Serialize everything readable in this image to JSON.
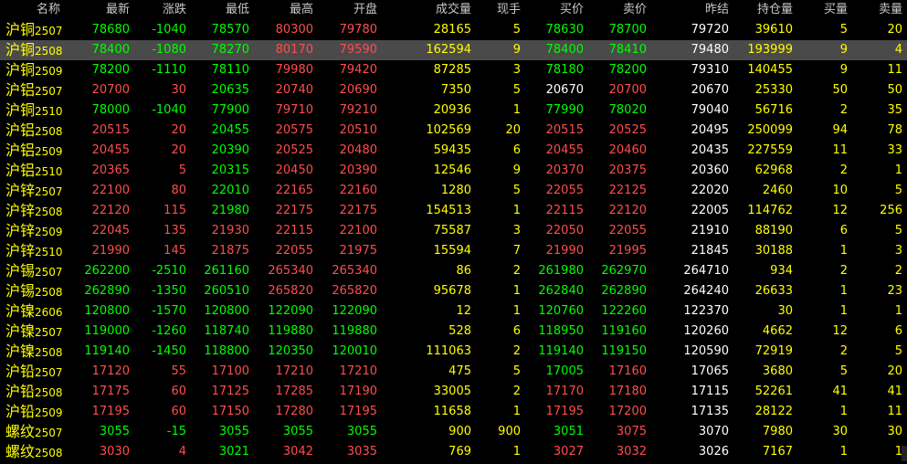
{
  "colors": {
    "up": "#ff4d4d",
    "down": "#00ff00",
    "flat": "#ffffff",
    "accent": "#ffff00",
    "header": "#c8c8c8",
    "selected_row": "#4a4a4a"
  },
  "columns": [
    {
      "key": "name",
      "label": "名称"
    },
    {
      "key": "last",
      "label": "最新"
    },
    {
      "key": "change",
      "label": "涨跌"
    },
    {
      "key": "low",
      "label": "最低"
    },
    {
      "key": "high",
      "label": "最高"
    },
    {
      "key": "open",
      "label": "开盘"
    },
    {
      "key": "volume",
      "label": "成交量"
    },
    {
      "key": "hand",
      "label": "现手"
    },
    {
      "key": "bid",
      "label": "买价"
    },
    {
      "key": "ask",
      "label": "卖价"
    },
    {
      "key": "prev_settle",
      "label": "昨结"
    },
    {
      "key": "oi",
      "label": "持仓量"
    },
    {
      "key": "bid_vol",
      "label": "买量"
    },
    {
      "key": "ask_vol",
      "label": "卖量"
    }
  ],
  "selected_index": 1,
  "rows": [
    {
      "cn": "沪铜",
      "code": "2507",
      "last": "78680",
      "change": "-1040",
      "low": "78570",
      "high": "80300",
      "open": "79780",
      "volume": "28165",
      "hand": "5",
      "bid": "78630",
      "ask": "78700",
      "prev_settle": "79720",
      "oi": "39610",
      "bid_vol": "5",
      "ask_vol": "20",
      "c": {
        "last": "down",
        "change": "down",
        "low": "down",
        "high": "up",
        "open": "up",
        "bid": "down",
        "ask": "down"
      }
    },
    {
      "cn": "沪铜",
      "code": "2508",
      "last": "78400",
      "change": "-1080",
      "low": "78270",
      "high": "80170",
      "open": "79590",
      "volume": "162594",
      "hand": "9",
      "bid": "78400",
      "ask": "78410",
      "prev_settle": "79480",
      "oi": "193999",
      "bid_vol": "9",
      "ask_vol": "4",
      "c": {
        "last": "down",
        "change": "down",
        "low": "down",
        "high": "up",
        "open": "up",
        "bid": "down",
        "ask": "down"
      }
    },
    {
      "cn": "沪铜",
      "code": "2509",
      "last": "78200",
      "change": "-1110",
      "low": "78110",
      "high": "79980",
      "open": "79420",
      "volume": "87285",
      "hand": "3",
      "bid": "78180",
      "ask": "78200",
      "prev_settle": "79310",
      "oi": "140455",
      "bid_vol": "9",
      "ask_vol": "11",
      "c": {
        "last": "down",
        "change": "down",
        "low": "down",
        "high": "up",
        "open": "up",
        "bid": "down",
        "ask": "down"
      }
    },
    {
      "cn": "沪铝",
      "code": "2507",
      "last": "20700",
      "change": "30",
      "low": "20635",
      "high": "20740",
      "open": "20690",
      "volume": "7350",
      "hand": "5",
      "bid": "20670",
      "ask": "20700",
      "prev_settle": "20670",
      "oi": "25330",
      "bid_vol": "50",
      "ask_vol": "50",
      "c": {
        "last": "up",
        "change": "up",
        "low": "down",
        "high": "up",
        "open": "up",
        "bid": "flat",
        "ask": "up"
      }
    },
    {
      "cn": "沪铜",
      "code": "2510",
      "last": "78000",
      "change": "-1040",
      "low": "77900",
      "high": "79710",
      "open": "79210",
      "volume": "20936",
      "hand": "1",
      "bid": "77990",
      "ask": "78020",
      "prev_settle": "79040",
      "oi": "56716",
      "bid_vol": "2",
      "ask_vol": "35",
      "c": {
        "last": "down",
        "change": "down",
        "low": "down",
        "high": "up",
        "open": "up",
        "bid": "down",
        "ask": "down"
      }
    },
    {
      "cn": "沪铝",
      "code": "2508",
      "last": "20515",
      "change": "20",
      "low": "20455",
      "high": "20575",
      "open": "20510",
      "volume": "102569",
      "hand": "20",
      "bid": "20515",
      "ask": "20525",
      "prev_settle": "20495",
      "oi": "250099",
      "bid_vol": "94",
      "ask_vol": "78",
      "c": {
        "last": "up",
        "change": "up",
        "low": "down",
        "high": "up",
        "open": "up",
        "bid": "up",
        "ask": "up"
      }
    },
    {
      "cn": "沪铝",
      "code": "2509",
      "last": "20455",
      "change": "20",
      "low": "20390",
      "high": "20525",
      "open": "20480",
      "volume": "59435",
      "hand": "6",
      "bid": "20455",
      "ask": "20460",
      "prev_settle": "20435",
      "oi": "227559",
      "bid_vol": "11",
      "ask_vol": "33",
      "c": {
        "last": "up",
        "change": "up",
        "low": "down",
        "high": "up",
        "open": "up",
        "bid": "up",
        "ask": "up"
      }
    },
    {
      "cn": "沪铝",
      "code": "2510",
      "last": "20365",
      "change": "5",
      "low": "20315",
      "high": "20450",
      "open": "20390",
      "volume": "12546",
      "hand": "9",
      "bid": "20370",
      "ask": "20375",
      "prev_settle": "20360",
      "oi": "62968",
      "bid_vol": "2",
      "ask_vol": "1",
      "c": {
        "last": "up",
        "change": "up",
        "low": "down",
        "high": "up",
        "open": "up",
        "bid": "up",
        "ask": "up"
      }
    },
    {
      "cn": "沪锌",
      "code": "2507",
      "last": "22100",
      "change": "80",
      "low": "22010",
      "high": "22165",
      "open": "22160",
      "volume": "1280",
      "hand": "5",
      "bid": "22055",
      "ask": "22125",
      "prev_settle": "22020",
      "oi": "2460",
      "bid_vol": "10",
      "ask_vol": "5",
      "c": {
        "last": "up",
        "change": "up",
        "low": "down",
        "high": "up",
        "open": "up",
        "bid": "up",
        "ask": "up"
      }
    },
    {
      "cn": "沪锌",
      "code": "2508",
      "last": "22120",
      "change": "115",
      "low": "21980",
      "high": "22175",
      "open": "22175",
      "volume": "154513",
      "hand": "1",
      "bid": "22115",
      "ask": "22120",
      "prev_settle": "22005",
      "oi": "114762",
      "bid_vol": "12",
      "ask_vol": "256",
      "c": {
        "last": "up",
        "change": "up",
        "low": "down",
        "high": "up",
        "open": "up",
        "bid": "up",
        "ask": "up"
      }
    },
    {
      "cn": "沪锌",
      "code": "2509",
      "last": "22045",
      "change": "135",
      "low": "21930",
      "high": "22115",
      "open": "22100",
      "volume": "75587",
      "hand": "3",
      "bid": "22050",
      "ask": "22055",
      "prev_settle": "21910",
      "oi": "88190",
      "bid_vol": "6",
      "ask_vol": "5",
      "c": {
        "last": "up",
        "change": "up",
        "low": "up",
        "high": "up",
        "open": "up",
        "bid": "up",
        "ask": "up"
      }
    },
    {
      "cn": "沪锌",
      "code": "2510",
      "last": "21990",
      "change": "145",
      "low": "21875",
      "high": "22055",
      "open": "21975",
      "volume": "15594",
      "hand": "7",
      "bid": "21990",
      "ask": "21995",
      "prev_settle": "21845",
      "oi": "30188",
      "bid_vol": "1",
      "ask_vol": "3",
      "c": {
        "last": "up",
        "change": "up",
        "low": "up",
        "high": "up",
        "open": "up",
        "bid": "up",
        "ask": "up"
      }
    },
    {
      "cn": "沪锡",
      "code": "2507",
      "last": "262200",
      "change": "-2510",
      "low": "261160",
      "high": "265340",
      "open": "265340",
      "volume": "86",
      "hand": "2",
      "bid": "261980",
      "ask": "262970",
      "prev_settle": "264710",
      "oi": "934",
      "bid_vol": "2",
      "ask_vol": "2",
      "c": {
        "last": "down",
        "change": "down",
        "low": "down",
        "high": "up",
        "open": "up",
        "bid": "down",
        "ask": "down"
      }
    },
    {
      "cn": "沪锡",
      "code": "2508",
      "last": "262890",
      "change": "-1350",
      "low": "260510",
      "high": "265820",
      "open": "265820",
      "volume": "95678",
      "hand": "1",
      "bid": "262840",
      "ask": "262890",
      "prev_settle": "264240",
      "oi": "26633",
      "bid_vol": "1",
      "ask_vol": "23",
      "c": {
        "last": "down",
        "change": "down",
        "low": "down",
        "high": "up",
        "open": "up",
        "bid": "down",
        "ask": "down"
      }
    },
    {
      "cn": "沪镍",
      "code": "2606",
      "last": "120800",
      "change": "-1570",
      "low": "120800",
      "high": "122090",
      "open": "122090",
      "volume": "12",
      "hand": "1",
      "bid": "120760",
      "ask": "122260",
      "prev_settle": "122370",
      "oi": "30",
      "bid_vol": "1",
      "ask_vol": "1",
      "c": {
        "last": "down",
        "change": "down",
        "low": "down",
        "high": "down",
        "open": "down",
        "bid": "down",
        "ask": "down"
      }
    },
    {
      "cn": "沪镍",
      "code": "2507",
      "last": "119000",
      "change": "-1260",
      "low": "118740",
      "high": "119880",
      "open": "119880",
      "volume": "528",
      "hand": "6",
      "bid": "118950",
      "ask": "119160",
      "prev_settle": "120260",
      "oi": "4662",
      "bid_vol": "12",
      "ask_vol": "6",
      "c": {
        "last": "down",
        "change": "down",
        "low": "down",
        "high": "down",
        "open": "down",
        "bid": "down",
        "ask": "down"
      }
    },
    {
      "cn": "沪镍",
      "code": "2508",
      "last": "119140",
      "change": "-1450",
      "low": "118800",
      "high": "120350",
      "open": "120010",
      "volume": "111063",
      "hand": "2",
      "bid": "119140",
      "ask": "119150",
      "prev_settle": "120590",
      "oi": "72919",
      "bid_vol": "2",
      "ask_vol": "5",
      "c": {
        "last": "down",
        "change": "down",
        "low": "down",
        "high": "down",
        "open": "down",
        "bid": "down",
        "ask": "down"
      }
    },
    {
      "cn": "沪铅",
      "code": "2507",
      "last": "17120",
      "change": "55",
      "low": "17100",
      "high": "17210",
      "open": "17210",
      "volume": "475",
      "hand": "5",
      "bid": "17005",
      "ask": "17160",
      "prev_settle": "17065",
      "oi": "3680",
      "bid_vol": "5",
      "ask_vol": "20",
      "c": {
        "last": "up",
        "change": "up",
        "low": "up",
        "high": "up",
        "open": "up",
        "bid": "down",
        "ask": "up"
      }
    },
    {
      "cn": "沪铅",
      "code": "2508",
      "last": "17175",
      "change": "60",
      "low": "17125",
      "high": "17285",
      "open": "17190",
      "volume": "33005",
      "hand": "2",
      "bid": "17170",
      "ask": "17180",
      "prev_settle": "17115",
      "oi": "52261",
      "bid_vol": "41",
      "ask_vol": "41",
      "c": {
        "last": "up",
        "change": "up",
        "low": "up",
        "high": "up",
        "open": "up",
        "bid": "up",
        "ask": "up"
      }
    },
    {
      "cn": "沪铅",
      "code": "2509",
      "last": "17195",
      "change": "60",
      "low": "17150",
      "high": "17280",
      "open": "17195",
      "volume": "11658",
      "hand": "1",
      "bid": "17195",
      "ask": "17200",
      "prev_settle": "17135",
      "oi": "28122",
      "bid_vol": "1",
      "ask_vol": "11",
      "c": {
        "last": "up",
        "change": "up",
        "low": "up",
        "high": "up",
        "open": "up",
        "bid": "up",
        "ask": "up"
      }
    },
    {
      "cn": "螺纹",
      "code": "2507",
      "last": "3055",
      "change": "-15",
      "low": "3055",
      "high": "3055",
      "open": "3055",
      "volume": "900",
      "hand": "900",
      "bid": "3051",
      "ask": "3075",
      "prev_settle": "3070",
      "oi": "7980",
      "bid_vol": "30",
      "ask_vol": "30",
      "c": {
        "last": "down",
        "change": "down",
        "low": "down",
        "high": "down",
        "open": "down",
        "bid": "down",
        "ask": "up"
      }
    },
    {
      "cn": "螺纹",
      "code": "2508",
      "last": "3030",
      "change": "4",
      "low": "3021",
      "high": "3042",
      "open": "3035",
      "volume": "769",
      "hand": "1",
      "bid": "3027",
      "ask": "3032",
      "prev_settle": "3026",
      "oi": "7167",
      "bid_vol": "1",
      "ask_vol": "1",
      "c": {
        "last": "up",
        "change": "up",
        "low": "down",
        "high": "up",
        "open": "up",
        "bid": "up",
        "ask": "up"
      }
    }
  ]
}
